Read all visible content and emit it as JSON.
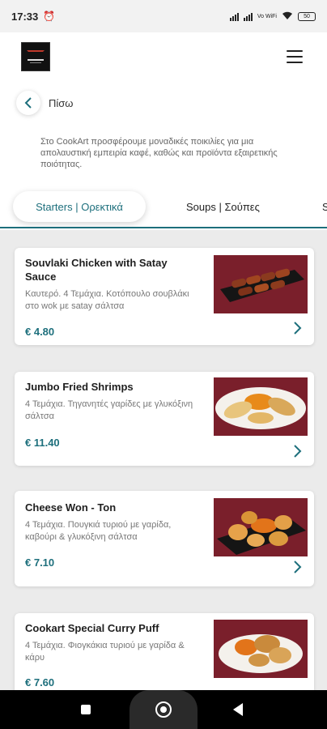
{
  "status_bar": {
    "time": "17:33",
    "alarm_icon": "alarm-icon",
    "network": "Vo WiFi",
    "battery": "50"
  },
  "header": {
    "logo": "cookart-logo",
    "menu_icon": "menu-icon"
  },
  "back": {
    "label": "Πίσω",
    "icon": "chevron-left-icon"
  },
  "intro_text": "Στο CookArt προσφέρουμε μοναδικές ποικιλίες για μια απολαυστική εμπειρία καφέ, καθώς και προϊόντα εξαιρετικής ποιότητας.",
  "tabs": [
    {
      "label": "Starters | Ορεκτικά",
      "active": true
    },
    {
      "label": "Soups | Σούπες",
      "active": false
    },
    {
      "label": "S",
      "active": false
    }
  ],
  "menu_items": [
    {
      "name": "Souvlaki Chicken with Satay Sauce",
      "description": "Καυτερό. 4 Τεμάχια. Κοτόπουλο σουβλάκι στο wok με satay σάλτσα",
      "price": "€ 4.80"
    },
    {
      "name": "Jumbo Fried Shrimps",
      "description": "4 Τεμάχια. Τηγανητές γαρίδες με γλυκόξινη σάλτσα",
      "price": "€ 11.40"
    },
    {
      "name": "Cheese Won - Ton",
      "description": "4 Τεμάχια. Πουγκιά τυριού με γαρίδα, καβούρι & γλυκόξινη σάλτσα",
      "price": "€ 7.10"
    },
    {
      "name": "Cookart Special Curry Puff",
      "description": "4 Τεμάχια. Φιογκάκια τυριού με γαρίδα & κάρυ",
      "price": "€ 7.60"
    }
  ],
  "colors": {
    "accent": "#1d6f7c",
    "list_background": "#ebebeb",
    "food_background": "#7a1f2b"
  },
  "nav_bar": {
    "recent_icon": "square-icon",
    "home_icon": "home-icon",
    "back_icon": "back-triangle-icon"
  }
}
